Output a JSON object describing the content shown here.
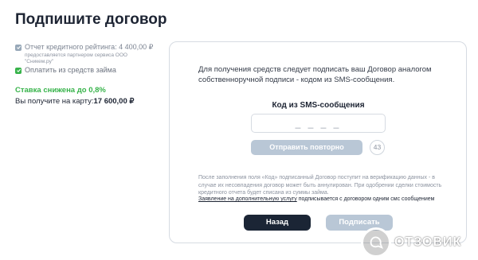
{
  "page": {
    "title": "Подпишите договор"
  },
  "sidebar": {
    "credit_report": "Отчет кредитного рейтинга: 4 400,00 ₽",
    "credit_report_note": "предоставляется партнером сервиса ООО \"Сникем.ру\"",
    "pay_from_loan": "Оплатить из средств займа",
    "rate_reduced": "Ставка снижена до 0,8%",
    "receive_label": "Вы получите на карту:",
    "receive_amount": "17 600,00 ₽"
  },
  "panel": {
    "instruction": "Для получения средств следует подписать ваш Договор аналогом собственноручной подписи - кодом из SMS-сообщения.",
    "code_label": "Код из SMS-сообщения",
    "code_placeholder": "_ _ _ _",
    "resend_label": "Отправить повторно",
    "timer": "43",
    "note": "После заполнения поля «Код» подписанный Договор поступит на верификацию данных - в случае их несовпадения договор может быть аннулирован. При одобрении сделки стоимость кредитного отчета будет списана из суммы займа.",
    "extra_service_link": "Заявление на дополнительную услугу",
    "extra_service_text": " подписывается с договором одним смс сообщением",
    "back_label": "Назад",
    "sign_label": "Подписать"
  },
  "watermark": {
    "text": "ОТЗОВИК"
  },
  "colors": {
    "accent_green": "#37b34a",
    "dark_button": "#1b2535",
    "disabled_button": "#b9c7d6"
  }
}
